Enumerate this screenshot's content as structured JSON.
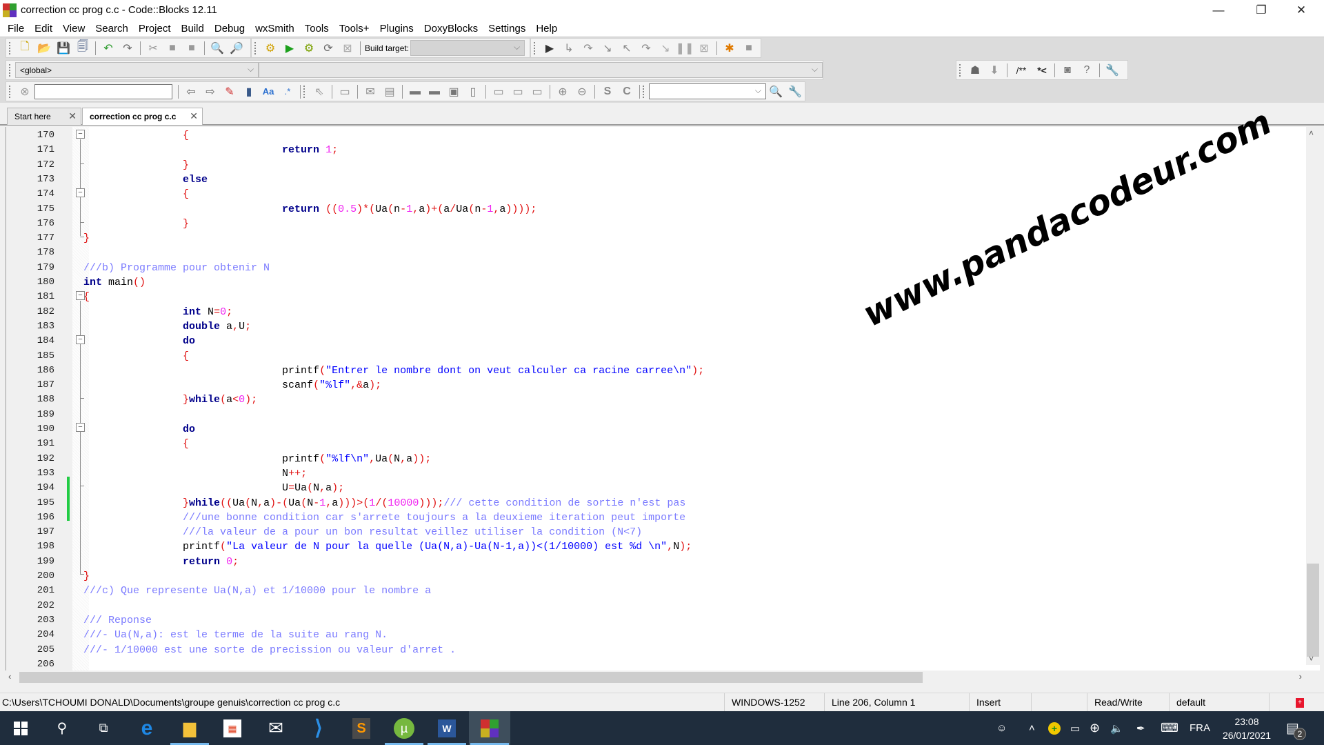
{
  "window": {
    "title": "correction cc prog c.c - Code::Blocks 12.11",
    "controls": {
      "minimize": "—",
      "restore": "❐",
      "close": "✕"
    }
  },
  "menu": [
    "File",
    "Edit",
    "View",
    "Search",
    "Project",
    "Build",
    "Debug",
    "wxSmith",
    "Tools",
    "Tools+",
    "Plugins",
    "DoxyBlocks",
    "Settings",
    "Help"
  ],
  "toolbar": {
    "build_target_label": "Build target:",
    "build_target_value": "",
    "scope_value": "<global>",
    "function_value": "",
    "search_value": "",
    "doxy_labels": [
      "/**",
      "*<"
    ],
    "find_combo_value": ""
  },
  "tabs": [
    {
      "label": "Start here",
      "active": false
    },
    {
      "label": "correction cc prog c.c",
      "active": true
    }
  ],
  "editor": {
    "lines": [
      {
        "n": "170",
        "tokens": [
          [
            "op",
            "\t\t{"
          ]
        ]
      },
      {
        "n": "171",
        "tokens": [
          [
            "plain",
            "\t\t\t\t"
          ],
          [
            "kw",
            "return"
          ],
          [
            "plain",
            " "
          ],
          [
            "num",
            "1"
          ],
          [
            "op",
            ";"
          ]
        ]
      },
      {
        "n": "172",
        "tokens": [
          [
            "op",
            "\t\t}"
          ]
        ]
      },
      {
        "n": "173",
        "tokens": [
          [
            "plain",
            "\t\t"
          ],
          [
            "kw",
            "else"
          ]
        ]
      },
      {
        "n": "174",
        "tokens": [
          [
            "op",
            "\t\t{"
          ]
        ]
      },
      {
        "n": "175",
        "tokens": [
          [
            "plain",
            "\t\t\t\t"
          ],
          [
            "kw",
            "return"
          ],
          [
            "plain",
            " "
          ],
          [
            "op",
            "(("
          ],
          [
            "num",
            "0.5"
          ],
          [
            "op",
            ")*("
          ],
          [
            "plain",
            "Ua"
          ],
          [
            "op",
            "("
          ],
          [
            "plain",
            "n"
          ],
          [
            "op",
            "-"
          ],
          [
            "num",
            "1"
          ],
          [
            "op",
            ","
          ],
          [
            "plain",
            "a"
          ],
          [
            "op",
            ")+("
          ],
          [
            "plain",
            "a"
          ],
          [
            "op",
            "/"
          ],
          [
            "plain",
            "Ua"
          ],
          [
            "op",
            "("
          ],
          [
            "plain",
            "n"
          ],
          [
            "op",
            "-"
          ],
          [
            "num",
            "1"
          ],
          [
            "op",
            ","
          ],
          [
            "plain",
            "a"
          ],
          [
            "op",
            "))));"
          ]
        ]
      },
      {
        "n": "176",
        "tokens": [
          [
            "op",
            "\t\t}"
          ]
        ]
      },
      {
        "n": "177",
        "tokens": [
          [
            "op",
            "}"
          ]
        ]
      },
      {
        "n": "178",
        "tokens": []
      },
      {
        "n": "179",
        "tokens": [
          [
            "cmt",
            "///b) Programme pour obtenir N"
          ]
        ]
      },
      {
        "n": "180",
        "tokens": [
          [
            "kw",
            "int"
          ],
          [
            "plain",
            " main"
          ],
          [
            "op",
            "()"
          ]
        ]
      },
      {
        "n": "181",
        "tokens": [
          [
            "op",
            "{"
          ]
        ]
      },
      {
        "n": "182",
        "tokens": [
          [
            "plain",
            "\t\t"
          ],
          [
            "kw",
            "int"
          ],
          [
            "plain",
            " N"
          ],
          [
            "op",
            "="
          ],
          [
            "num",
            "0"
          ],
          [
            "op",
            ";"
          ]
        ]
      },
      {
        "n": "183",
        "tokens": [
          [
            "plain",
            "\t\t"
          ],
          [
            "kw",
            "double"
          ],
          [
            "plain",
            " a"
          ],
          [
            "op",
            ","
          ],
          [
            "plain",
            "U"
          ],
          [
            "op",
            ";"
          ]
        ]
      },
      {
        "n": "184",
        "tokens": [
          [
            "plain",
            "\t\t"
          ],
          [
            "kw",
            "do"
          ]
        ]
      },
      {
        "n": "185",
        "tokens": [
          [
            "op",
            "\t\t{"
          ]
        ]
      },
      {
        "n": "186",
        "tokens": [
          [
            "plain",
            "\t\t\t\tprintf"
          ],
          [
            "op",
            "("
          ],
          [
            "str",
            "\"Entrer le nombre dont on veut calculer ca racine carree\\n\""
          ],
          [
            "op",
            ");"
          ]
        ]
      },
      {
        "n": "187",
        "tokens": [
          [
            "plain",
            "\t\t\t\tscanf"
          ],
          [
            "op",
            "("
          ],
          [
            "str",
            "\"%lf\""
          ],
          [
            "op",
            ",&"
          ],
          [
            "plain",
            "a"
          ],
          [
            "op",
            ");"
          ]
        ]
      },
      {
        "n": "188",
        "tokens": [
          [
            "op",
            "\t\t}"
          ],
          [
            "kw",
            "while"
          ],
          [
            "op",
            "("
          ],
          [
            "plain",
            "a"
          ],
          [
            "op",
            "<"
          ],
          [
            "num",
            "0"
          ],
          [
            "op",
            ");"
          ]
        ]
      },
      {
        "n": "189",
        "tokens": []
      },
      {
        "n": "190",
        "tokens": [
          [
            "plain",
            "\t\t"
          ],
          [
            "kw",
            "do"
          ]
        ]
      },
      {
        "n": "191",
        "tokens": [
          [
            "op",
            "\t\t{"
          ]
        ]
      },
      {
        "n": "192",
        "tokens": [
          [
            "plain",
            "\t\t\t\tprintf"
          ],
          [
            "op",
            "("
          ],
          [
            "str",
            "\"%lf\\n\""
          ],
          [
            "op",
            ","
          ],
          [
            "plain",
            "Ua"
          ],
          [
            "op",
            "("
          ],
          [
            "plain",
            "N"
          ],
          [
            "op",
            ","
          ],
          [
            "plain",
            "a"
          ],
          [
            "op",
            "));"
          ]
        ]
      },
      {
        "n": "193",
        "tokens": [
          [
            "plain",
            "\t\t\t\tN"
          ],
          [
            "op",
            "++;"
          ]
        ]
      },
      {
        "n": "194",
        "tokens": [
          [
            "plain",
            "\t\t\t\tU"
          ],
          [
            "op",
            "="
          ],
          [
            "plain",
            "Ua"
          ],
          [
            "op",
            "("
          ],
          [
            "plain",
            "N"
          ],
          [
            "op",
            ","
          ],
          [
            "plain",
            "a"
          ],
          [
            "op",
            ");"
          ]
        ]
      },
      {
        "n": "195",
        "tokens": [
          [
            "op",
            "\t\t}"
          ],
          [
            "kw",
            "while"
          ],
          [
            "op",
            "(("
          ],
          [
            "plain",
            "Ua"
          ],
          [
            "op",
            "("
          ],
          [
            "plain",
            "N"
          ],
          [
            "op",
            ","
          ],
          [
            "plain",
            "a"
          ],
          [
            "op",
            ")-("
          ],
          [
            "plain",
            "Ua"
          ],
          [
            "op",
            "("
          ],
          [
            "plain",
            "N"
          ],
          [
            "op",
            "-"
          ],
          [
            "num",
            "1"
          ],
          [
            "op",
            ","
          ],
          [
            "plain",
            "a"
          ],
          [
            "op",
            ")))>("
          ],
          [
            "num",
            "1"
          ],
          [
            "op",
            "/("
          ],
          [
            "num",
            "10000"
          ],
          [
            "op",
            ")));"
          ],
          [
            "cmt",
            "/// cette condition de sortie n'est pas"
          ]
        ]
      },
      {
        "n": "196",
        "tokens": [
          [
            "plain",
            "\t\t"
          ],
          [
            "cmt",
            "///une bonne condition car s'arrete toujours a la deuxieme iteration peut importe"
          ]
        ]
      },
      {
        "n": "197",
        "tokens": [
          [
            "plain",
            "\t\t"
          ],
          [
            "cmt",
            "///la valeur de a pour un bon resultat veillez utiliser la condition (N<7)"
          ]
        ]
      },
      {
        "n": "198",
        "tokens": [
          [
            "plain",
            "\t\tprintf"
          ],
          [
            "op",
            "("
          ],
          [
            "str",
            "\"La valeur de N pour la quelle (Ua(N,a)-Ua(N-1,a))<(1/10000) est %d \\n\""
          ],
          [
            "op",
            ","
          ],
          [
            "plain",
            "N"
          ],
          [
            "op",
            ");"
          ]
        ]
      },
      {
        "n": "199",
        "tokens": [
          [
            "plain",
            "\t\t"
          ],
          [
            "kw",
            "return"
          ],
          [
            "plain",
            " "
          ],
          [
            "num",
            "0"
          ],
          [
            "op",
            ";"
          ]
        ]
      },
      {
        "n": "200",
        "tokens": [
          [
            "op",
            "}"
          ]
        ]
      },
      {
        "n": "201",
        "tokens": [
          [
            "cmt",
            "///c) Que represente Ua(N,a) et 1/10000 pour le nombre a"
          ]
        ]
      },
      {
        "n": "202",
        "tokens": []
      },
      {
        "n": "203",
        "tokens": [
          [
            "cmt",
            "/// Reponse"
          ]
        ]
      },
      {
        "n": "204",
        "tokens": [
          [
            "cmt",
            "///- Ua(N,a): est le terme de la suite au rang N."
          ]
        ]
      },
      {
        "n": "205",
        "tokens": [
          [
            "cmt",
            "///- 1/10000 est une sorte de precission ou valeur d'arret ."
          ]
        ]
      },
      {
        "n": "206",
        "tokens": []
      }
    ]
  },
  "watermark": "www.pandacodeur.com",
  "statusbar": {
    "path": "C:\\Users\\TCHOUMI DONALD\\Documents\\groupe genuis\\correction cc prog c.c",
    "encoding": "WINDOWS-1252",
    "position": "Line 206, Column 1",
    "mode": "Insert",
    "access": "Read/Write",
    "lang": "default"
  },
  "taskbar": {
    "apps": [
      "start",
      "search",
      "task-view",
      "edge",
      "file-explorer",
      "store",
      "mail",
      "vscode",
      "sublime",
      "utorrent",
      "word",
      "codeblocks"
    ],
    "language": "FRA",
    "time": "23:08",
    "date": "26/01/2021",
    "notifications": "2"
  },
  "colors": {
    "keyword": "#00008b",
    "number": "#f020f0",
    "operator": "#e01010",
    "string": "#0000ff",
    "comment": "#7b7bff",
    "taskbar": "#1f2d3d"
  }
}
